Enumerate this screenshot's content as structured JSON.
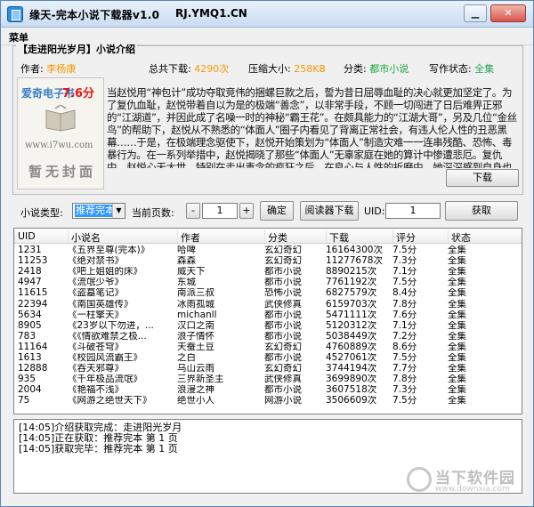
{
  "window": {
    "title": "缘天-完本小说下载器v1.0",
    "site": "RJ.YMQ1.CN"
  },
  "menu": {
    "label": "菜单"
  },
  "book": {
    "legend_title": "【走进阳光岁月】",
    "legend_suffix": "小说介绍",
    "author_label": "作者:",
    "author": "李杨康",
    "downloads_label": "总共下载:",
    "downloads": "4290次",
    "size_label": "压缩大小:",
    "size": "258KB",
    "category_label": "分类:",
    "category": "都市小说",
    "status_label": "写作状态:",
    "status": "全集",
    "intro": "当赵悦用“神包计”成功夺取竞伟的捆螺巨款之后，誓为昔日屈辱血耻的决心就更加坚定了。为了复仇血耻，赵悦带着自以为是的极端“善念”，以非常手段，不顾一切闯进了日后难畀正邪的“江湖道”，并因此成了名噪一时的神秘“霸王花”。在颇具能力的“江湖大哥”，另及几位“金丝鸟”的帮助下，赵悦从不熟悉的“体面人”圈子内看见了背离正常社会，有违人伦人性的丑恶黑幕……于是，在极端理念驱使下，赵悦开始策划为“体面人”制造灾难一一连串残酷、恐怖、毒暴行为。在一系列举措中，赵悦揭晓了那些“体面人”无辜家庭在她的算计中惨遭悲厄。复仇中，赵悦心无太世，特别在走出毒念的疯狂之后，在良心与人性的折磨中，她深深感到自身也遭遇良心被泯灭，被领籍的黠诚，到底是……赵悦难以承受的灵魂之痛，终于明白天下不容罪的报应，原来的“雄心”因此淡化……",
    "download_button": "下载"
  },
  "cover": {
    "site_text": "爱奇电子书",
    "score": "7.6分",
    "url": "www.i7wu.com",
    "placeholder": "暂无封面"
  },
  "toolbar": {
    "type_label": "小说类型:",
    "type_value": "推荐完本",
    "page_label": "当前页数:",
    "minus": "-",
    "page": "1",
    "plus": "+",
    "confirm": "确定",
    "reader_download": "阅读器下载",
    "uid_label": "UID:",
    "uid_value": "1",
    "fetch": "获取"
  },
  "table": {
    "headers": [
      "UID",
      "小说名",
      "作者",
      "分类",
      "下载",
      "评分",
      "状态"
    ],
    "rows": [
      [
        "1231",
        "《五界至尊(完本)》",
        "哈啤",
        "玄幻奇幻",
        "16164300次",
        "7.5分",
        "全集"
      ],
      [
        "11253",
        "《绝对禁书》",
        "森森",
        "玄幻奇幻",
        "11277678次",
        "7.3分",
        "全集"
      ],
      [
        "2418",
        "《吧上姐姐的床》",
        "威天下",
        "都市小说",
        "8890215次",
        "7.1分",
        "全集"
      ],
      [
        "4947",
        "《流氓少爷》",
        "东城",
        "都市小说",
        "7761192次",
        "7.5分",
        "全集"
      ],
      [
        "11615",
        "《盗墓笔记》",
        "南派三叔",
        "恐怖小说",
        "6827579次",
        "8.4分",
        "全集"
      ],
      [
        "22394",
        "《南国英雄传》",
        "冰雨孤城",
        "武侠修真",
        "6159703次",
        "7.8分",
        "全集"
      ],
      [
        "5634",
        "《一柱擎天》",
        "michanll",
        "都市小说",
        "5471111次",
        "7.6分",
        "全集"
      ],
      [
        "8905",
        "《23岁以下勿进，...",
        "汉口之南",
        "都市小说",
        "5120312次",
        "7.1分",
        "全集"
      ],
      [
        "783",
        "《《情欲难禁之极...",
        "浪子情怀",
        "都市小说",
        "5038449次",
        "7.2分",
        "全集"
      ],
      [
        "11164",
        "《斗破苍穹》",
        "天蚕土豆",
        "玄幻奇幻",
        "4760889次",
        "8.6分",
        "全集"
      ],
      [
        "1613",
        "《校园风流霸王》",
        "之白",
        "都市小说",
        "4527061次",
        "7.5分",
        "全集"
      ],
      [
        "12888",
        "《吞天邪尊》",
        "乌山云雨",
        "玄幻奇幻",
        "3744194次",
        "7.7分",
        "全集"
      ],
      [
        "935",
        "《千年极品流氓》",
        "三界新圣主",
        "武侠修真",
        "3699890次",
        "7.8分",
        "全集"
      ],
      [
        "2004",
        "《艳福不浅》",
        "浪漫之神",
        "都市小说",
        "3607518次",
        "7.3分",
        "全集"
      ],
      [
        "75",
        "《网游之绝世天下》",
        "绝世小人",
        "网游小说",
        "3506609次",
        "7.5分",
        "全集"
      ]
    ]
  },
  "log": {
    "lines": [
      "[14:05]介绍获取完成：走进阳光岁月",
      "[14:05]正在获取：推荐完本 第 1 页",
      "[14:05]获取完毕：推荐完本 第 1 页"
    ]
  },
  "watermark": {
    "title": "当下软件园",
    "url": "www.downxia.com"
  }
}
